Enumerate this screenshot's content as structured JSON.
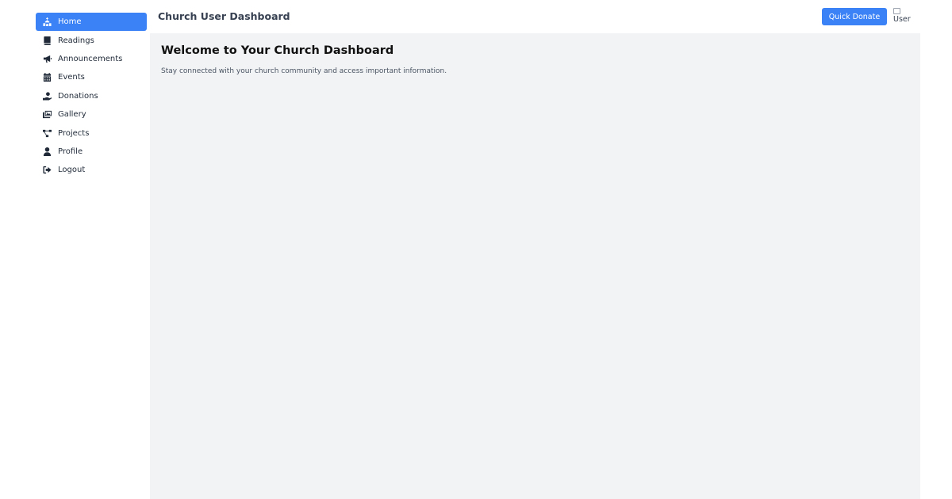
{
  "header": {
    "title": "Church User Dashboard",
    "quick_donate_label": "Quick Donate",
    "avatar_alt": "User"
  },
  "sidebar": {
    "items": [
      {
        "label": "Home",
        "icon": "church-icon",
        "active": true
      },
      {
        "label": "Readings",
        "icon": "book-icon",
        "active": false
      },
      {
        "label": "Announcements",
        "icon": "megaphone-icon",
        "active": false
      },
      {
        "label": "Events",
        "icon": "calendar-icon",
        "active": false
      },
      {
        "label": "Donations",
        "icon": "donate-hand-icon",
        "active": false
      },
      {
        "label": "Gallery",
        "icon": "images-icon",
        "active": false
      },
      {
        "label": "Projects",
        "icon": "project-diagram-icon",
        "active": false
      },
      {
        "label": "Profile",
        "icon": "user-icon",
        "active": false
      },
      {
        "label": "Logout",
        "icon": "sign-out-icon",
        "active": false
      }
    ]
  },
  "main": {
    "title": "Welcome to Your Church Dashboard",
    "subtitle": "Stay connected with your church community and access important information."
  },
  "colors": {
    "accent": "#3b82f6",
    "main_background": "#f2f3f5"
  }
}
